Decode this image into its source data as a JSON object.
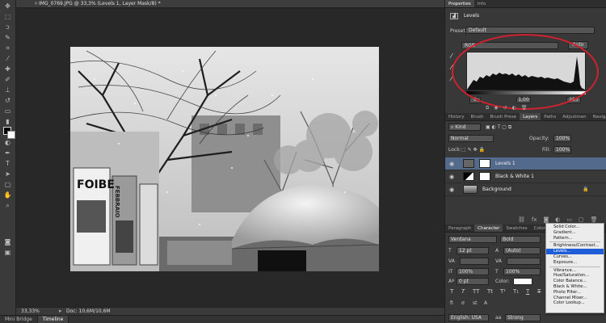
{
  "document": {
    "tab_title": "IMG_0769.JPG @ 33,3% (Levels 1, Layer Mask/8) *",
    "zoom": "33,33%",
    "doc_size": "Doc: 10,6M/10,6M",
    "sign_text": "FOIBE",
    "sign_text2": "FEBBRAIO"
  },
  "bottom_tabs": [
    "Mini Bridge",
    "Timeline"
  ],
  "properties": {
    "tabs": [
      "Properties",
      "Info"
    ],
    "title": "Levels",
    "preset_label": "Preset:",
    "preset_value": "Default",
    "channel": "RGB",
    "auto_label": "Auto",
    "input_black": "0",
    "input_gamma": "1,00",
    "input_white": "255",
    "annotation_color": "#d2212e"
  },
  "layers_panel": {
    "tabs": [
      "History",
      "Brush",
      "Brush Prese",
      "Layers",
      "Paths",
      "Adjustmen",
      "Navigator"
    ],
    "kind_label": "Kind",
    "blend_mode": "Normal",
    "opacity_label": "Opacity:",
    "opacity_value": "100%",
    "lock_label": "Lock:",
    "fill_label": "Fill:",
    "fill_value": "100%",
    "layers": [
      {
        "name": "Levels 1",
        "selected": true
      },
      {
        "name": "Black & White 1",
        "selected": false
      },
      {
        "name": "Background",
        "selected": false
      }
    ]
  },
  "character": {
    "tabs": [
      "Paragraph",
      "Character",
      "Swatches",
      "Color"
    ],
    "font_family": "Verdana",
    "font_style": "Bold",
    "font_size": "12 pt",
    "leading": "(Auto)",
    "vertical_scale": "100%",
    "horizontal_scale": "100%",
    "baseline": "0 pt",
    "color_label": "Color:",
    "language": "English: USA",
    "antialias": "Strong"
  },
  "adjustment_menu": [
    "Solid Color...",
    "Gradient...",
    "Pattern...",
    "-",
    "Brightness/Contrast...",
    "Levels...",
    "Curves...",
    "Exposure...",
    "-",
    "Vibrance...",
    "Hue/Saturation...",
    "Color Balance...",
    "Black & White...",
    "Photo Filter...",
    "Channel Mixer...",
    "Color Lookup..."
  ],
  "adjustment_menu_selected": "Levels..."
}
